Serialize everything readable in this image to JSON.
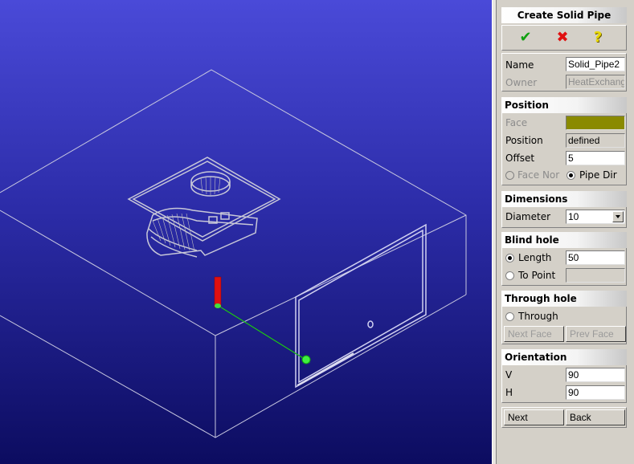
{
  "panel": {
    "title": "Create Solid Pipe",
    "toolbar": {
      "ok_icon": "check-icon",
      "cancel_icon": "x-icon",
      "help_icon": "question-icon"
    },
    "name_label": "Name",
    "name_value": "Solid_Pipe2",
    "owner_label": "Owner",
    "owner_value": "HeatExchange",
    "position": {
      "title": "Position",
      "face_label": "Face",
      "face_color": "#8a8a00",
      "position_label": "Position",
      "position_value": "defined",
      "offset_label": "Offset",
      "offset_value": "5",
      "face_nor_label": "Face Nor",
      "pipe_dir_label": "Pipe Dir"
    },
    "dimensions": {
      "title": "Dimensions",
      "diameter_label": "Diameter",
      "diameter_value": "10"
    },
    "blind_hole": {
      "title": "Blind hole",
      "length_label": "Length",
      "length_value": "50",
      "to_point_label": "To Point"
    },
    "through_hole": {
      "title": "Through hole",
      "through_label": "Through",
      "next_face": "Next Face",
      "prev_face": "Prev Face"
    },
    "orientation": {
      "title": "Orientation",
      "v_label": "V",
      "v_value": "90",
      "h_label": "H",
      "h_value": "90"
    },
    "next_button": "Next",
    "back_button": "Back"
  },
  "colors": {
    "viewport_top": "#4a4ad8",
    "viewport_bottom": "#0c0c60",
    "axis_red": "#e01010",
    "axis_green": "#30e030",
    "wireframe": "#c8c8e0",
    "component": "#c0c0c0"
  }
}
